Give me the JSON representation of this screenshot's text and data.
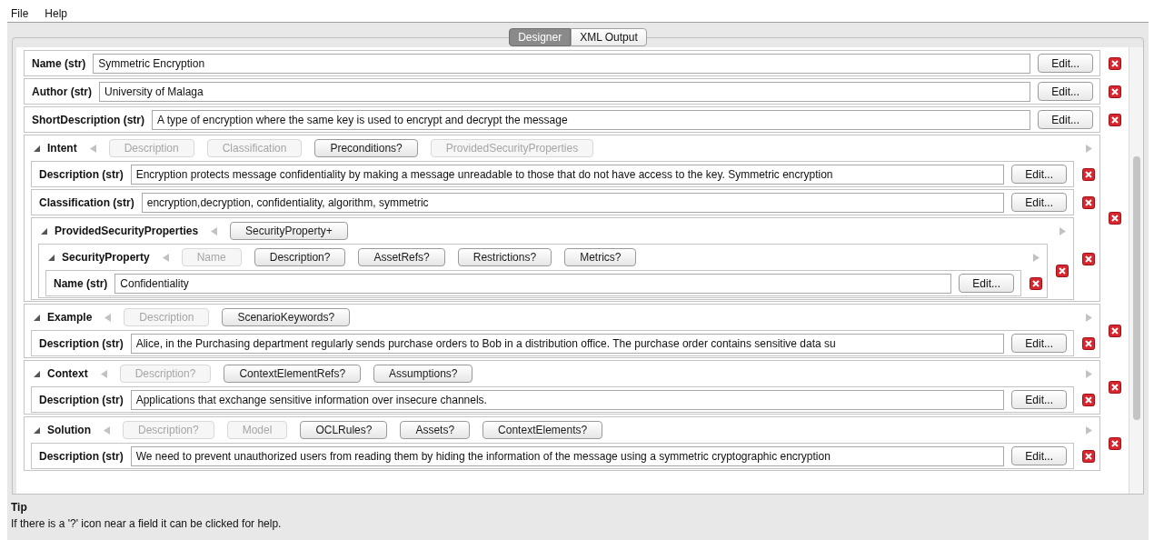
{
  "menu": [
    {
      "label": "File"
    },
    {
      "label": "Help"
    }
  ],
  "tabs": [
    {
      "label": "Designer",
      "selected": true
    },
    {
      "label": "XML Output",
      "selected": false
    }
  ],
  "items": [
    {
      "kind": "field",
      "label": "Name (str)",
      "value": "Symmetric Encryption",
      "button": "Edit..."
    },
    {
      "kind": "field",
      "label": "Author (str)",
      "value": "University of Malaga",
      "button": "Edit..."
    },
    {
      "kind": "field",
      "label": "ShortDescription (str)",
      "value": "A type of encryption where the same key is used to encrypt and decrypt the message",
      "button": "Edit..."
    },
    {
      "kind": "section",
      "title": "Intent",
      "expanded": true,
      "buttons": [
        {
          "label": "Description",
          "disabled": true
        },
        {
          "label": "Classification",
          "disabled": true
        },
        {
          "label": "Preconditions?",
          "disabled": false
        },
        {
          "label": "ProvidedSecurityProperties",
          "disabled": true
        }
      ],
      "children": [
        {
          "kind": "field",
          "label": "Description (str)",
          "value": "Encryption protects message confidentiality by making a message unreadable to those that do not have access to the key. Symmetric encryption",
          "button": "Edit..."
        },
        {
          "kind": "field",
          "label": "Classification (str)",
          "value": "encryption,decryption, confidentiality, algorithm, symmetric",
          "button": "Edit..."
        },
        {
          "kind": "section",
          "title": "ProvidedSecurityProperties",
          "expanded": true,
          "buttons": [
            {
              "label": "SecurityProperty+",
              "disabled": false
            }
          ],
          "children": [
            {
              "kind": "section",
              "title": "SecurityProperty",
              "expanded": true,
              "buttons": [
                {
                  "label": "Name",
                  "disabled": true
                },
                {
                  "label": "Description?",
                  "disabled": false
                },
                {
                  "label": "AssetRefs?",
                  "disabled": false
                },
                {
                  "label": "Restrictions?",
                  "disabled": false
                },
                {
                  "label": "Metrics?",
                  "disabled": false
                }
              ],
              "children": [
                {
                  "kind": "field",
                  "label": "Name (str)",
                  "value": "Confidentiality",
                  "button": "Edit..."
                }
              ]
            }
          ]
        }
      ]
    },
    {
      "kind": "section",
      "title": "Example",
      "expanded": true,
      "buttons": [
        {
          "label": "Description",
          "disabled": true
        },
        {
          "label": "ScenarioKeywords?",
          "disabled": false
        }
      ],
      "children": [
        {
          "kind": "field",
          "label": "Description (str)",
          "value": "Alice, in the Purchasing department regularly sends purchase orders to Bob in a distribution office. The purchase order contains sensitive data su",
          "button": "Edit..."
        }
      ]
    },
    {
      "kind": "section",
      "title": "Context",
      "expanded": true,
      "buttons": [
        {
          "label": "Description?",
          "disabled": true
        },
        {
          "label": "ContextElementRefs?",
          "disabled": false
        },
        {
          "label": "Assumptions?",
          "disabled": false
        }
      ],
      "children": [
        {
          "kind": "field",
          "label": "Description (str)",
          "value": "Applications that exchange sensitive information over insecure channels.",
          "button": "Edit..."
        }
      ]
    },
    {
      "kind": "section",
      "title": "Solution",
      "expanded": true,
      "buttons": [
        {
          "label": "Description?",
          "disabled": true
        },
        {
          "label": "Model",
          "disabled": true
        },
        {
          "label": "OCLRules?",
          "disabled": false
        },
        {
          "label": "Assets?",
          "disabled": false
        },
        {
          "label": "ContextElements?",
          "disabled": false
        }
      ],
      "children": [
        {
          "kind": "field",
          "label": "Description (str)",
          "value": "We need to prevent unauthorized users from reading them by hiding the information of the message using a symmetric cryptographic encryption",
          "button": "Edit..."
        }
      ]
    }
  ],
  "tip": {
    "title": "Tip",
    "text": "If there is a '?' icon near a field it can be clicked for help."
  }
}
